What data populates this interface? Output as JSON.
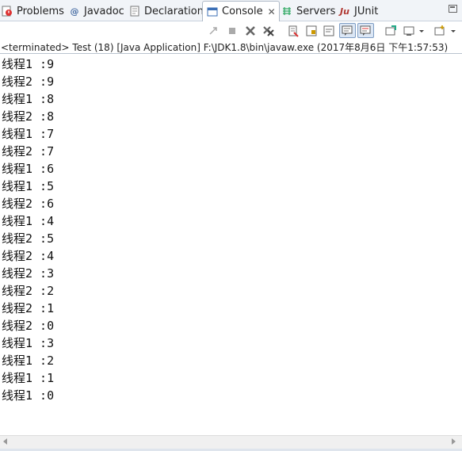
{
  "tabs": [
    {
      "label": "Problems",
      "icon": "problems-icon"
    },
    {
      "label": "Javadoc",
      "icon": "javadoc-icon"
    },
    {
      "label": "Declaration",
      "icon": "declaration-icon"
    },
    {
      "label": "Console",
      "icon": "console-icon",
      "active": true
    },
    {
      "label": "Servers",
      "icon": "servers-icon"
    },
    {
      "label": "JUnit",
      "icon": "junit-icon"
    }
  ],
  "status": "<terminated> Test (18) [Java Application] F:\\JDK1.8\\bin\\javaw.exe (2017年8月6日 下午1:57:53)",
  "output": [
    "线程1 :9",
    "线程2 :9",
    "线程1 :8",
    "线程2 :8",
    "线程1 :7",
    "线程2 :7",
    "线程1 :6",
    "线程1 :5",
    "线程2 :6",
    "线程1 :4",
    "线程2 :5",
    "线程2 :4",
    "线程2 :3",
    "线程2 :2",
    "线程2 :1",
    "线程2 :0",
    "线程1 :3",
    "线程1 :2",
    "线程1 :1",
    "线程1 :0"
  ],
  "colors": {
    "tabbar_bg": "#f1f4f8",
    "accent": "#3b6fb6"
  }
}
